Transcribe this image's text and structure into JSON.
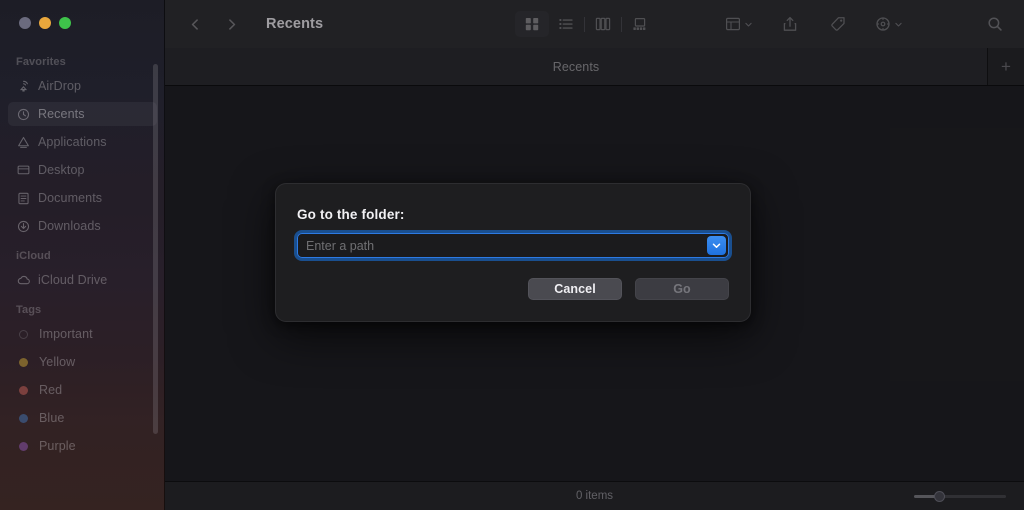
{
  "window": {
    "title": "Recents",
    "traffic_lights": [
      {
        "name": "close",
        "color": "#6b6b7e"
      },
      {
        "name": "minimize",
        "color": "#e9a73c"
      },
      {
        "name": "zoom",
        "color": "#3ec24a"
      }
    ]
  },
  "toolbar": {
    "back_icon": "chevron-left-icon",
    "forward_icon": "chevron-right-icon",
    "view_modes": [
      {
        "name": "icon-view",
        "label": "Icon View",
        "selected": true
      },
      {
        "name": "list-view",
        "label": "List View",
        "selected": false
      },
      {
        "name": "column-view",
        "label": "Column View",
        "selected": false
      },
      {
        "name": "gallery-view",
        "label": "Gallery View",
        "selected": false
      }
    ],
    "actions": [
      {
        "name": "group-by",
        "label": "Group"
      },
      {
        "name": "share",
        "label": "Share"
      },
      {
        "name": "tag",
        "label": "Tag"
      },
      {
        "name": "action-menu",
        "label": "Action"
      },
      {
        "name": "search",
        "label": "Search"
      }
    ]
  },
  "tabbar": {
    "active_tab": "Recents",
    "new_tab_label": "+"
  },
  "sidebar": {
    "sections": [
      {
        "title": "Favorites",
        "items": [
          {
            "label": "AirDrop",
            "icon": "airdrop-icon",
            "selected": false
          },
          {
            "label": "Recents",
            "icon": "clock-icon",
            "selected": true
          },
          {
            "label": "Applications",
            "icon": "applications-icon",
            "selected": false
          },
          {
            "label": "Desktop",
            "icon": "desktop-icon",
            "selected": false
          },
          {
            "label": "Documents",
            "icon": "documents-icon",
            "selected": false
          },
          {
            "label": "Downloads",
            "icon": "downloads-icon",
            "selected": false
          }
        ]
      },
      {
        "title": "iCloud",
        "items": [
          {
            "label": "iCloud Drive",
            "icon": "icloud-icon",
            "selected": false
          }
        ]
      },
      {
        "title": "Tags",
        "items": [
          {
            "label": "Important",
            "icon": "tag-dot-hollow",
            "color": "transparent",
            "selected": false
          },
          {
            "label": "Yellow",
            "icon": "tag-dot",
            "color": "#d8b13c",
            "selected": false
          },
          {
            "label": "Red",
            "icon": "tag-dot",
            "color": "#d4685f",
            "selected": false
          },
          {
            "label": "Blue",
            "icon": "tag-dot",
            "color": "#4a7fc4",
            "selected": false
          },
          {
            "label": "Purple",
            "icon": "tag-dot",
            "color": "#9a5fc0",
            "selected": false
          }
        ]
      }
    ]
  },
  "statusbar": {
    "item_count": "0 items",
    "zoom_slider_value": "25"
  },
  "dialog": {
    "title": "Go to the folder:",
    "path_placeholder": "Enter a path",
    "path_value": "",
    "dropdown_icon": "chevron-down-icon",
    "cancel_label": "Cancel",
    "go_label": "Go",
    "go_disabled": true,
    "accent_color": "#2c7ae4"
  }
}
